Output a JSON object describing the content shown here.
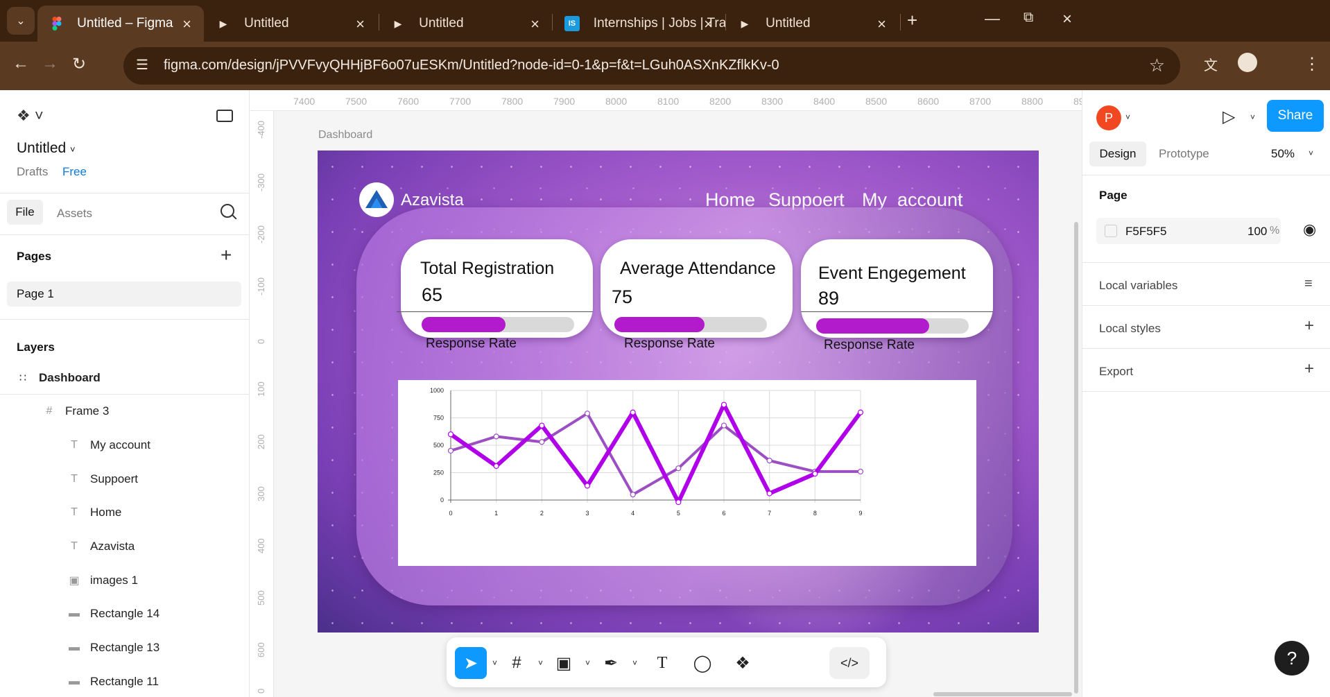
{
  "browser": {
    "tabs": [
      {
        "title": "Untitled – Figma",
        "icon": "figma-icon",
        "active": true
      },
      {
        "title": "Untitled",
        "icon": "play-icon",
        "active": false
      },
      {
        "title": "Untitled",
        "icon": "play-icon",
        "active": false
      },
      {
        "title": "Internships | Jobs | Training",
        "icon": "is-logo-icon",
        "active": false
      },
      {
        "title": "Untitled",
        "icon": "play-icon",
        "active": false
      }
    ],
    "url": "figma.com/design/jPVVFvyQHHjBF6o07uESKm/Untitled?node-id=0-1&p=f&t=LGuh0ASXnKZflkKv-0"
  },
  "left_panel": {
    "file_title": "Untitled",
    "drafts": "Drafts",
    "plan": "Free",
    "tabs": {
      "file": "File",
      "assets": "Assets"
    },
    "pages_heading": "Pages",
    "pages": [
      "Page 1"
    ],
    "layers_heading": "Layers",
    "layers": [
      {
        "name": "Dashboard",
        "icon": "frame-group-icon"
      },
      {
        "name": "Frame 3",
        "icon": "hash-frame-icon"
      },
      {
        "name": "My account",
        "icon": "text-icon"
      },
      {
        "name": "Suppoert",
        "icon": "text-icon"
      },
      {
        "name": "Home",
        "icon": "text-icon"
      },
      {
        "name": "Azavista",
        "icon": "text-icon"
      },
      {
        "name": "images 1",
        "icon": "image-icon"
      },
      {
        "name": "Rectangle 14",
        "icon": "rectangle-icon"
      },
      {
        "name": "Rectangle 13",
        "icon": "rectangle-icon"
      },
      {
        "name": "Rectangle 11",
        "icon": "rectangle-icon"
      }
    ]
  },
  "canvas": {
    "ruler_top": [
      "7400",
      "7500",
      "7600",
      "7700",
      "7800",
      "7900",
      "8000",
      "8100",
      "8200",
      "8300",
      "8400",
      "8500",
      "8600",
      "8700",
      "8800",
      "89"
    ],
    "ruler_left": [
      "-400",
      "-300",
      "-200",
      "-100",
      "0",
      "100",
      "200",
      "300",
      "400",
      "500",
      "600",
      "0"
    ],
    "frame_label": "Dashboard"
  },
  "design": {
    "brand": "Azavista",
    "nav": {
      "home": "Home",
      "support": "Suppoert",
      "account": "My  account"
    },
    "stats": [
      {
        "title": "Total Registration",
        "value": "65",
        "label": "Response Rate",
        "fill": 0.55
      },
      {
        "title": "Average Attendance",
        "value": "75",
        "label": "Response Rate",
        "fill": 0.59
      },
      {
        "title": "Event Engegement",
        "value": "89",
        "label": "Response Rate",
        "fill": 0.74
      }
    ]
  },
  "chart_data": {
    "type": "line",
    "x": [
      0,
      1,
      2,
      3,
      4,
      5,
      6,
      7,
      8,
      9
    ],
    "ylim": [
      0,
      1000
    ],
    "yticks": [
      0,
      250,
      500,
      750,
      1000
    ],
    "grid": true,
    "series": [
      {
        "values": [
          450,
          580,
          530,
          790,
          50,
          290,
          680,
          360,
          260,
          260
        ],
        "color": "#9b4fc2"
      },
      {
        "values": [
          600,
          310,
          680,
          130,
          800,
          -20,
          870,
          60,
          240,
          800
        ],
        "color": "#b000ea"
      }
    ]
  },
  "toolbar_tools": [
    "move-icon",
    "frame-icon",
    "image-tool-icon",
    "pen-icon",
    "text-tool-icon",
    "comment-icon",
    "components-icon",
    "dev-mode-icon"
  ],
  "right_panel": {
    "avatar_letter": "P",
    "share": "Share",
    "tabs": {
      "design": "Design",
      "prototype": "Prototype"
    },
    "zoom": "50%",
    "page_heading": "Page",
    "bg_hex": "F5F5F5",
    "bg_opacity": "100",
    "pct": "%",
    "sections": [
      "Local variables",
      "Local styles",
      "Export"
    ],
    "help": "?"
  }
}
